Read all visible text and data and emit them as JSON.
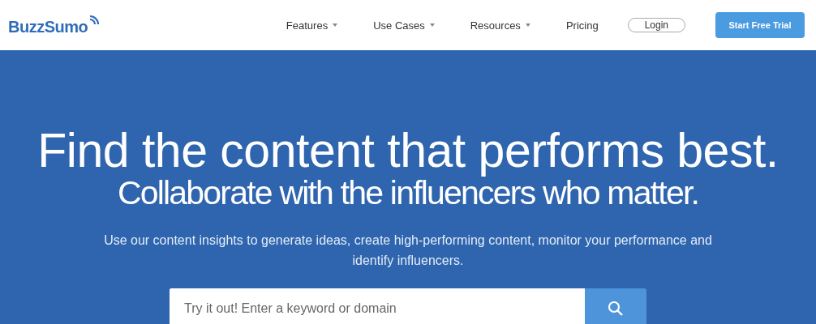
{
  "header": {
    "logo": "BuzzSumo",
    "nav": [
      {
        "label": "Features",
        "dropdown": true
      },
      {
        "label": "Use Cases",
        "dropdown": true
      },
      {
        "label": "Resources",
        "dropdown": true
      },
      {
        "label": "Pricing",
        "dropdown": false
      }
    ],
    "login": "Login",
    "cta": "Start Free Trial"
  },
  "hero": {
    "title": "Find the content that performs best.",
    "subtitle": "Collaborate with the influencers who matter.",
    "description": "Use our content insights to generate ideas, create high-performing content, monitor your performance and identify influencers.",
    "search": {
      "placeholder": "Try it out! Enter a keyword or domain"
    }
  }
}
